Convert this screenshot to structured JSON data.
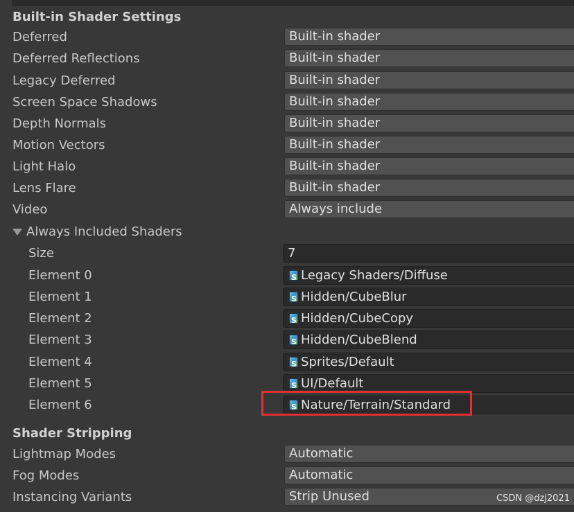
{
  "builtin": {
    "header": "Built-in Shader Settings",
    "rows": [
      {
        "label": "Deferred",
        "value": "Built-in shader"
      },
      {
        "label": "Deferred Reflections",
        "value": "Built-in shader"
      },
      {
        "label": "Legacy Deferred",
        "value": "Built-in shader"
      },
      {
        "label": "Screen Space Shadows",
        "value": "Built-in shader"
      },
      {
        "label": "Depth Normals",
        "value": "Built-in shader"
      },
      {
        "label": "Motion Vectors",
        "value": "Built-in shader"
      },
      {
        "label": "Light Halo",
        "value": "Built-in shader"
      },
      {
        "label": "Lens Flare",
        "value": "Built-in shader"
      },
      {
        "label": "Video",
        "value": "Always include"
      }
    ]
  },
  "always_included": {
    "label": "Always Included Shaders",
    "expanded": true,
    "size_label": "Size",
    "size_value": "7",
    "elements": [
      {
        "label": "Element 0",
        "value": "Legacy Shaders/Diffuse",
        "icon": "shader-icon"
      },
      {
        "label": "Element 1",
        "value": "Hidden/CubeBlur",
        "icon": "shader-icon"
      },
      {
        "label": "Element 2",
        "value": "Hidden/CubeCopy",
        "icon": "shader-icon"
      },
      {
        "label": "Element 3",
        "value": "Hidden/CubeBlend",
        "icon": "shader-icon"
      },
      {
        "label": "Element 4",
        "value": "Sprites/Default",
        "icon": "shader-icon"
      },
      {
        "label": "Element 5",
        "value": "UI/Default",
        "icon": "shader-icon"
      },
      {
        "label": "Element 6",
        "value": "Nature/Terrain/Standard",
        "icon": "shader-icon"
      }
    ]
  },
  "stripping": {
    "header": "Shader Stripping",
    "rows": [
      {
        "label": "Lightmap Modes",
        "value": "Automatic"
      },
      {
        "label": "Fog Modes",
        "value": "Automatic"
      },
      {
        "label": "Instancing Variants",
        "value": "Strip Unused"
      }
    ]
  },
  "highlight_color": "#e0302f",
  "watermark": "CSDN @dzj2021"
}
